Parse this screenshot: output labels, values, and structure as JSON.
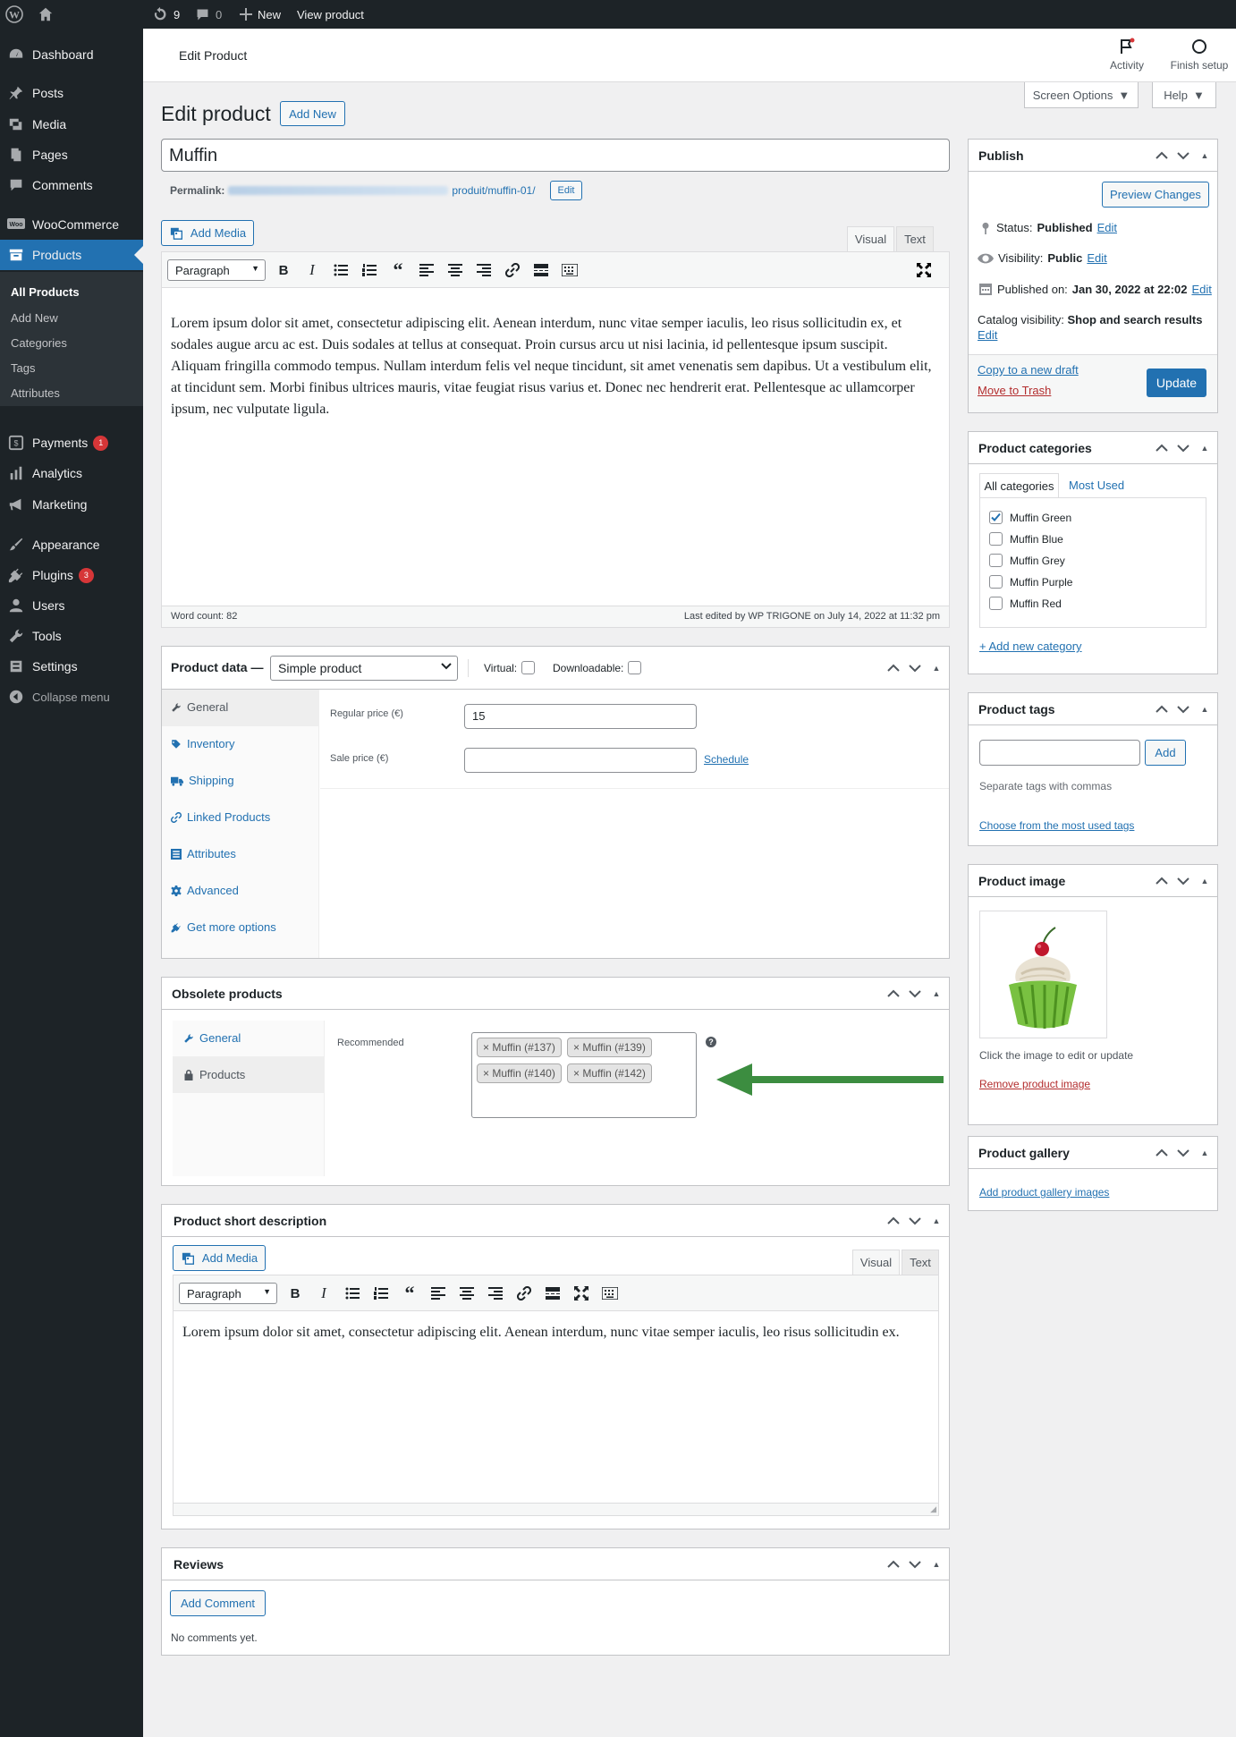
{
  "adminbar": {
    "updates": "9",
    "comments": "0",
    "new_label": "New",
    "view_label": "View product"
  },
  "sidebar": {
    "items": [
      "Dashboard",
      "Posts",
      "Media",
      "Pages",
      "Comments",
      "WooCommerce",
      "Products",
      "Payments",
      "Analytics",
      "Marketing",
      "Appearance",
      "Plugins",
      "Users",
      "Tools",
      "Settings",
      "Collapse menu"
    ],
    "payments_badge": "1",
    "plugins_badge": "3",
    "submenu": [
      "All Products",
      "Add New",
      "Categories",
      "Tags",
      "Attributes"
    ]
  },
  "header": {
    "title": "Edit Product",
    "activity": "Activity",
    "finish_setup": "Finish setup",
    "screen_options": "Screen Options",
    "help": "Help"
  },
  "page": {
    "heading": "Edit product",
    "add_new": "Add New",
    "product_title": "Muffin",
    "permalink_label": "Permalink:",
    "permalink_slug": "produit/muffin-01/",
    "permalink_edit": "Edit",
    "add_media": "Add Media",
    "tab_visual": "Visual",
    "tab_text": "Text",
    "format_select": "Paragraph",
    "body": "Lorem ipsum dolor sit amet, consectetur adipiscing elit. Aenean interdum, nunc vitae semper iaculis, leo risus sollicitudin ex, et sodales augue arcu ac est. Duis sodales at tellus at consequat. Proin cursus arcu ut nisi lacinia, id pellentesque ipsum suscipit. Aliquam fringilla commodo tempus. Nullam interdum felis vel neque tincidunt, sit amet venenatis sem dapibus. Ut a vestibulum elit, at tincidunt sem. Morbi finibus ultrices mauris, vitae feugiat risus varius et. Donec nec hendrerit erat. Pellentesque ac ullamcorper ipsum, nec vulputate ligula.",
    "word_count": "Word count: 82",
    "last_edited": "Last edited by WP TRIGONE on July 14, 2022 at 11:32 pm"
  },
  "product_data": {
    "label": "Product data —",
    "type": "Simple product",
    "virtual": "Virtual:",
    "downloadable": "Downloadable:",
    "tabs": [
      "General",
      "Inventory",
      "Shipping",
      "Linked Products",
      "Attributes",
      "Advanced",
      "Get more options"
    ],
    "regular_price_label": "Regular price (€)",
    "regular_price": "15",
    "sale_price_label": "Sale price (€)",
    "schedule": "Schedule"
  },
  "obsolete": {
    "title": "Obsolete products",
    "tabs": [
      "General",
      "Products"
    ],
    "recommended_label": "Recommended",
    "tags": [
      "× Muffin (#137)",
      "× Muffin (#139)",
      "× Muffin (#140)",
      "× Muffin (#142)"
    ],
    "help": "?"
  },
  "short_desc": {
    "title": "Product short description",
    "add_media": "Add Media",
    "tab_visual": "Visual",
    "tab_text": "Text",
    "format_select": "Paragraph",
    "body": "Lorem ipsum dolor sit amet, consectetur adipiscing elit. Aenean interdum, nunc vitae semper iaculis, leo risus sollicitudin ex."
  },
  "reviews": {
    "title": "Reviews",
    "add_comment": "Add Comment",
    "empty": "No comments yet."
  },
  "publish": {
    "title": "Publish",
    "preview": "Preview Changes",
    "status_label": "Status:",
    "status": "Published",
    "visibility_label": "Visibility:",
    "visibility": "Public",
    "published_label": "Published on:",
    "published": "Jan 30, 2022 at 22:02",
    "edit": "Edit",
    "catalog_label": "Catalog visibility:",
    "catalog": "Shop and search results",
    "copy_draft": "Copy to a new draft",
    "trash": "Move to Trash",
    "update": "Update"
  },
  "categories": {
    "title": "Product categories",
    "tab_all": "All categories",
    "tab_most": "Most Used",
    "items": [
      "Muffin Green",
      "Muffin Blue",
      "Muffin Grey",
      "Muffin Purple",
      "Muffin Red"
    ],
    "add_new": "+ Add new category"
  },
  "tags_box": {
    "title": "Product tags",
    "add": "Add",
    "hint": "Separate tags with commas",
    "choose": "Choose from the most used tags"
  },
  "image_box": {
    "title": "Product image",
    "hint": "Click the image to edit or update",
    "remove": "Remove product image"
  },
  "gallery": {
    "title": "Product gallery",
    "add": "Add product gallery images"
  },
  "colors": {
    "accent": "#2271b1",
    "sidebar": "#1d2327",
    "arrow": "#3c8d40",
    "danger": "#d63638"
  }
}
